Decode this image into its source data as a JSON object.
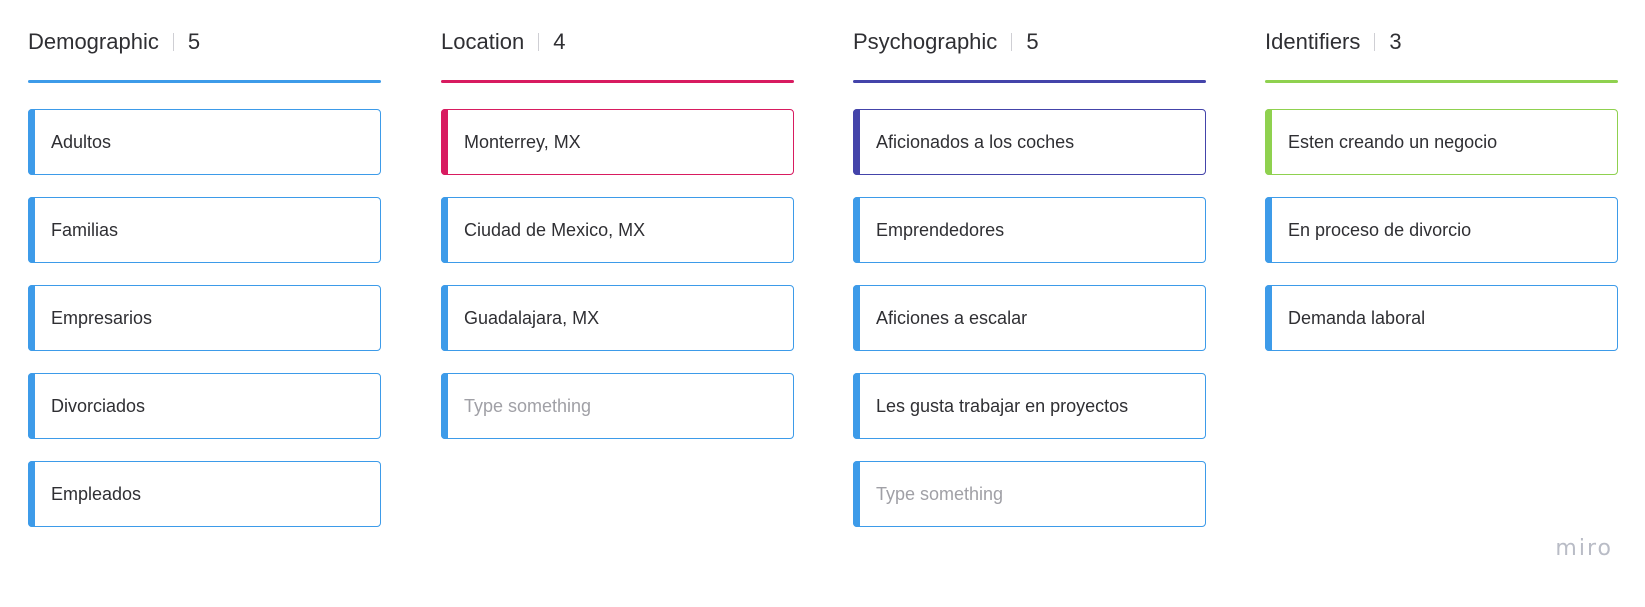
{
  "colors": {
    "demographic": "#3d9be9",
    "location": "#d81b60",
    "psychographic": "#4444aa",
    "identifiers": "#8fd14f",
    "card_default": "#3d9be9"
  },
  "columns": [
    {
      "title": "Demographic",
      "count": "5",
      "cards": [
        {
          "text": "Adultos"
        },
        {
          "text": "Familias"
        },
        {
          "text": "Empresarios"
        },
        {
          "text": "Divorciados"
        },
        {
          "text": "Empleados"
        }
      ]
    },
    {
      "title": "Location",
      "count": "4",
      "cards": [
        {
          "text": "Monterrey, MX"
        },
        {
          "text": "Ciudad de Mexico, MX"
        },
        {
          "text": "Guadalajara, MX"
        },
        {
          "placeholder": "Type something"
        }
      ]
    },
    {
      "title": "Psychographic",
      "count": "5",
      "cards": [
        {
          "text": "Aficionados a los coches"
        },
        {
          "text": "Emprendedores"
        },
        {
          "text": "Aficiones a escalar"
        },
        {
          "text": "Les gusta trabajar en proyectos"
        },
        {
          "placeholder": "Type something"
        }
      ]
    },
    {
      "title": "Identifiers",
      "count": "3",
      "cards": [
        {
          "text": "Esten creando un negocio"
        },
        {
          "text": "En proceso de divorcio"
        },
        {
          "text": "Demanda laboral"
        }
      ]
    }
  ],
  "watermark": "miro"
}
